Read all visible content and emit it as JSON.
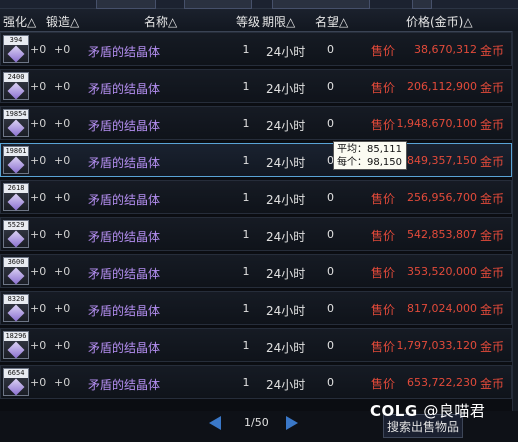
{
  "header": {
    "col_strengthen": "强化△",
    "col_forge": "锻造△",
    "col_name": "名称△",
    "col_level": "等级",
    "col_period": "期限△",
    "col_fame": "名望△",
    "col_price": "价格(金币)△"
  },
  "rows": [
    {
      "count": "394",
      "strengthen": "+0",
      "forge": "+0",
      "name": "矛盾的结晶体",
      "level": "1",
      "period": "24小时",
      "fame": "0",
      "sell": "售价",
      "price": "38,670,312",
      "unit": "金币"
    },
    {
      "count": "2400",
      "strengthen": "+0",
      "forge": "+0",
      "name": "矛盾的结晶体",
      "level": "1",
      "period": "24小时",
      "fame": "0",
      "sell": "售价",
      "price": "206,112,900",
      "unit": "金币"
    },
    {
      "count": "19854",
      "strengthen": "+0",
      "forge": "+0",
      "name": "矛盾的结晶体",
      "level": "1",
      "period": "24小时",
      "fame": "0",
      "sell": "售价",
      "price": "1,948,670,100",
      "unit": "金币"
    },
    {
      "count": "19861",
      "strengthen": "+0",
      "forge": "+0",
      "name": "矛盾的结晶体",
      "level": "1",
      "period": "24小时",
      "fame": "0",
      "sell": "售价",
      "price": "849,357,150",
      "unit": "金币"
    },
    {
      "count": "2618",
      "strengthen": "+0",
      "forge": "+0",
      "name": "矛盾的结晶体",
      "level": "1",
      "period": "24小时",
      "fame": "0",
      "sell": "售价",
      "price": "256,956,700",
      "unit": "金币"
    },
    {
      "count": "5529",
      "strengthen": "+0",
      "forge": "+0",
      "name": "矛盾的结晶体",
      "level": "1",
      "period": "24小时",
      "fame": "0",
      "sell": "售价",
      "price": "542,853,807",
      "unit": "金币"
    },
    {
      "count": "3600",
      "strengthen": "+0",
      "forge": "+0",
      "name": "矛盾的结晶体",
      "level": "1",
      "period": "24小时",
      "fame": "0",
      "sell": "售价",
      "price": "353,520,000",
      "unit": "金币"
    },
    {
      "count": "8320",
      "strengthen": "+0",
      "forge": "+0",
      "name": "矛盾的结晶体",
      "level": "1",
      "period": "24小时",
      "fame": "0",
      "sell": "售价",
      "price": "817,024,000",
      "unit": "金币"
    },
    {
      "count": "18296",
      "strengthen": "+0",
      "forge": "+0",
      "name": "矛盾的结晶体",
      "level": "1",
      "period": "24小时",
      "fame": "0",
      "sell": "售价",
      "price": "1,797,033,120",
      "unit": "金币"
    },
    {
      "count": "6654",
      "strengthen": "+0",
      "forge": "+0",
      "name": "矛盾的结晶体",
      "level": "1",
      "period": "24小时",
      "fame": "0",
      "sell": "售价",
      "price": "653,722,230",
      "unit": "金币"
    }
  ],
  "tooltip": {
    "line1": "平均：85,111",
    "line2": "每个：98,150"
  },
  "pager": {
    "page": "1/50",
    "search_button": "搜索出售物品"
  },
  "watermark": {
    "brand": "COLG",
    "author": "@良喵君"
  },
  "selected_row": 3
}
